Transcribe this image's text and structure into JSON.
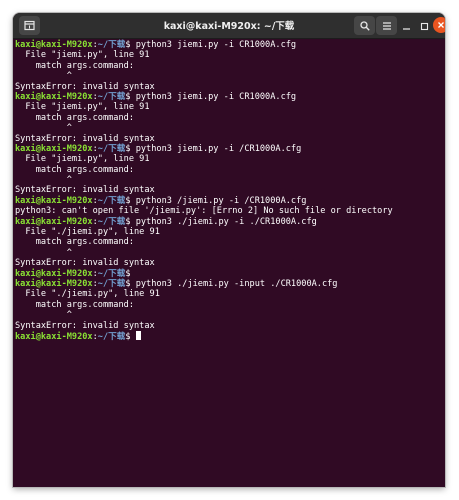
{
  "window": {
    "title": "kaxi@kaxi-M920x: ~/下载"
  },
  "icons": {
    "new_tab": "new-tab-icon",
    "search": "search-icon",
    "menu": "hamburger-menu-icon",
    "minimize": "minimize-icon",
    "maximize": "maximize-icon",
    "close": "close-icon"
  },
  "colors": {
    "terminal_bg": "#300a24",
    "prompt_user": "#8ae234",
    "prompt_path": "#729fcf",
    "close_button": "#e95420"
  },
  "prompt": {
    "user": "kaxi@kaxi-M920x",
    "sep": ":",
    "path": "~/下载",
    "symbol": "$ "
  },
  "lines": [
    {
      "type": "cmd",
      "text": "python3 jiemi.py -i CR1000A.cfg"
    },
    {
      "type": "out",
      "text": "  File \"jiemi.py\", line 91"
    },
    {
      "type": "out",
      "text": "    match args.command:"
    },
    {
      "type": "out",
      "text": "          ^"
    },
    {
      "type": "out",
      "text": "SyntaxError: invalid syntax"
    },
    {
      "type": "cmd",
      "text": "python3 jiemi.py -i CR1000A.cfg"
    },
    {
      "type": "out",
      "text": "  File \"jiemi.py\", line 91"
    },
    {
      "type": "out",
      "text": "    match args.command:"
    },
    {
      "type": "out",
      "text": "          ^"
    },
    {
      "type": "out",
      "text": "SyntaxError: invalid syntax"
    },
    {
      "type": "cmd",
      "text": "python3 jiemi.py -i /CR1000A.cfg"
    },
    {
      "type": "out",
      "text": "  File \"jiemi.py\", line 91"
    },
    {
      "type": "out",
      "text": "    match args.command:"
    },
    {
      "type": "out",
      "text": "          ^"
    },
    {
      "type": "out",
      "text": "SyntaxError: invalid syntax"
    },
    {
      "type": "cmd",
      "text": "python3 /jiemi.py -i /CR1000A.cfg"
    },
    {
      "type": "out",
      "text": "python3: can't open file '/jiemi.py': [Errno 2] No such file or directory"
    },
    {
      "type": "cmd",
      "text": "python3 ./jiemi.py -i ./CR1000A.cfg"
    },
    {
      "type": "out",
      "text": "  File \"./jiemi.py\", line 91"
    },
    {
      "type": "out",
      "text": "    match args.command:"
    },
    {
      "type": "out",
      "text": "          ^"
    },
    {
      "type": "out",
      "text": "SyntaxError: invalid syntax"
    },
    {
      "type": "cmd",
      "text": ""
    },
    {
      "type": "cmd",
      "text": "python3 ./jiemi.py -input ./CR1000A.cfg"
    },
    {
      "type": "out",
      "text": "  File \"./jiemi.py\", line 91"
    },
    {
      "type": "out",
      "text": "    match args.command:"
    },
    {
      "type": "out",
      "text": "          ^"
    },
    {
      "type": "out",
      "text": "SyntaxError: invalid syntax"
    },
    {
      "type": "cmd",
      "text": "",
      "cursor": true
    }
  ]
}
